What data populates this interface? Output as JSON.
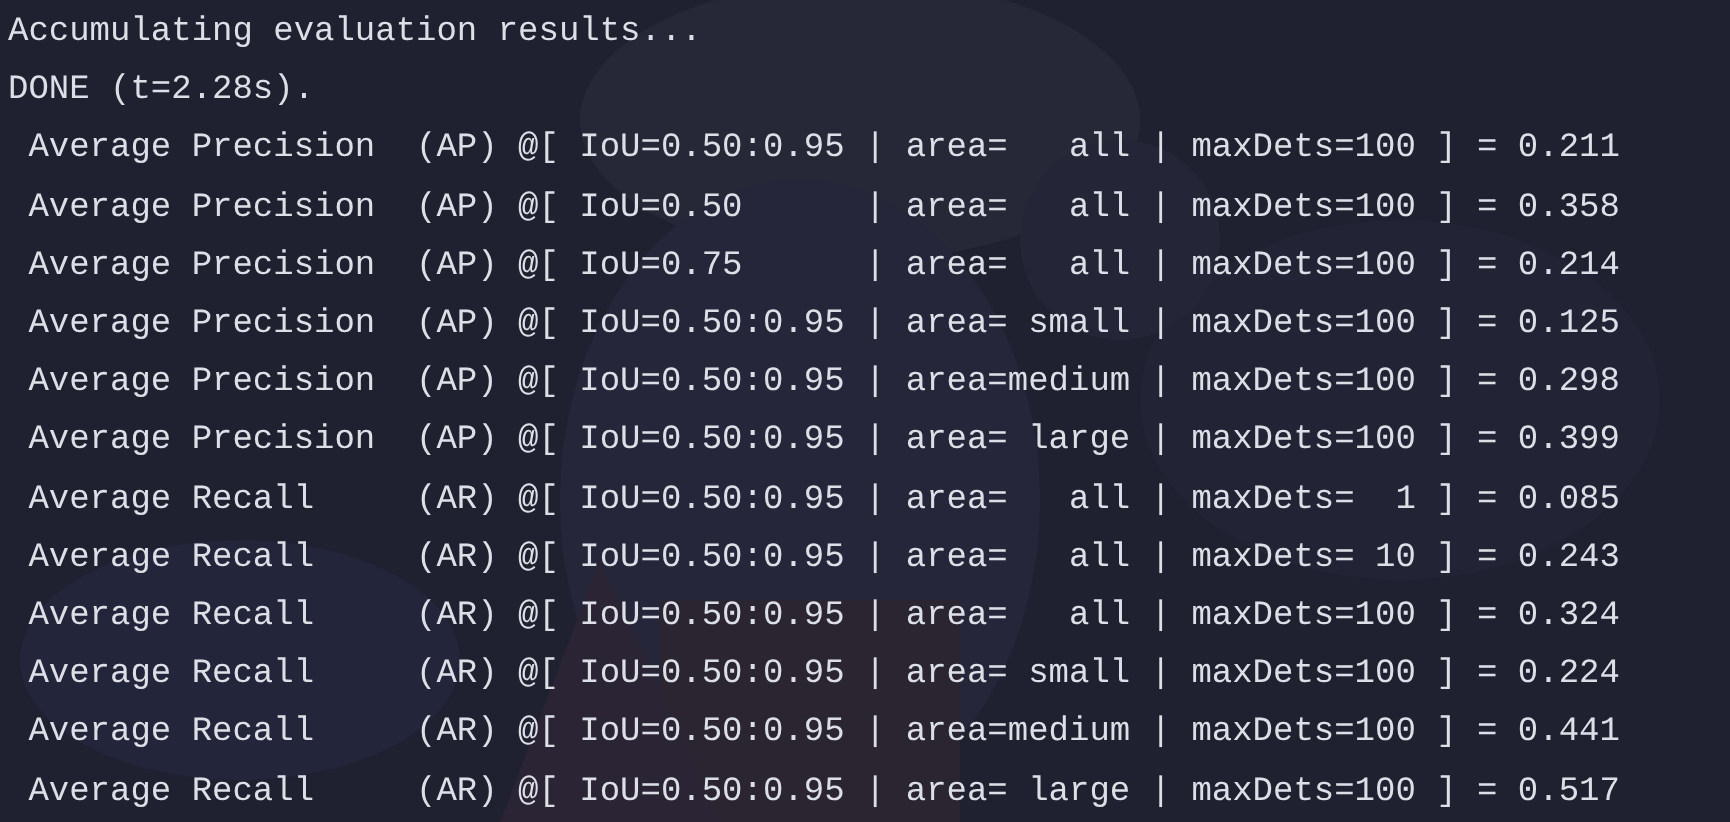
{
  "terminal": {
    "lines": [
      "Accumulating evaluation results...",
      "DONE (t=2.28s).",
      " Average Precision  (AP) @[ IoU=0.50:0.95 | area=   all | maxDets=100 ] = 0.211",
      " Average Precision  (AP) @[ IoU=0.50      | area=   all | maxDets=100 ] = 0.358",
      " Average Precision  (AP) @[ IoU=0.75      | area=   all | maxDets=100 ] = 0.214",
      " Average Precision  (AP) @[ IoU=0.50:0.95 | area= small | maxDets=100 ] = 0.125",
      " Average Precision  (AP) @[ IoU=0.50:0.95 | area=medium | maxDets=100 ] = 0.298",
      " Average Precision  (AP) @[ IoU=0.50:0.95 | area= large | maxDets=100 ] = 0.399",
      " Average Recall     (AR) @[ IoU=0.50:0.95 | area=   all | maxDets=  1 ] = 0.085",
      " Average Recall     (AR) @[ IoU=0.50:0.95 | area=   all | maxDets= 10 ] = 0.243",
      " Average Recall     (AR) @[ IoU=0.50:0.95 | area=   all | maxDets=100 ] = 0.324",
      " Average Recall     (AR) @[ IoU=0.50:0.95 | area= small | maxDets=100 ] = 0.224",
      " Average Recall     (AR) @[ IoU=0.50:0.95 | area=medium | maxDets=100 ] = 0.441",
      " Average Recall     (AR) @[ IoU=0.50:0.95 | area= large | maxDets=100 ] = 0.517"
    ]
  }
}
